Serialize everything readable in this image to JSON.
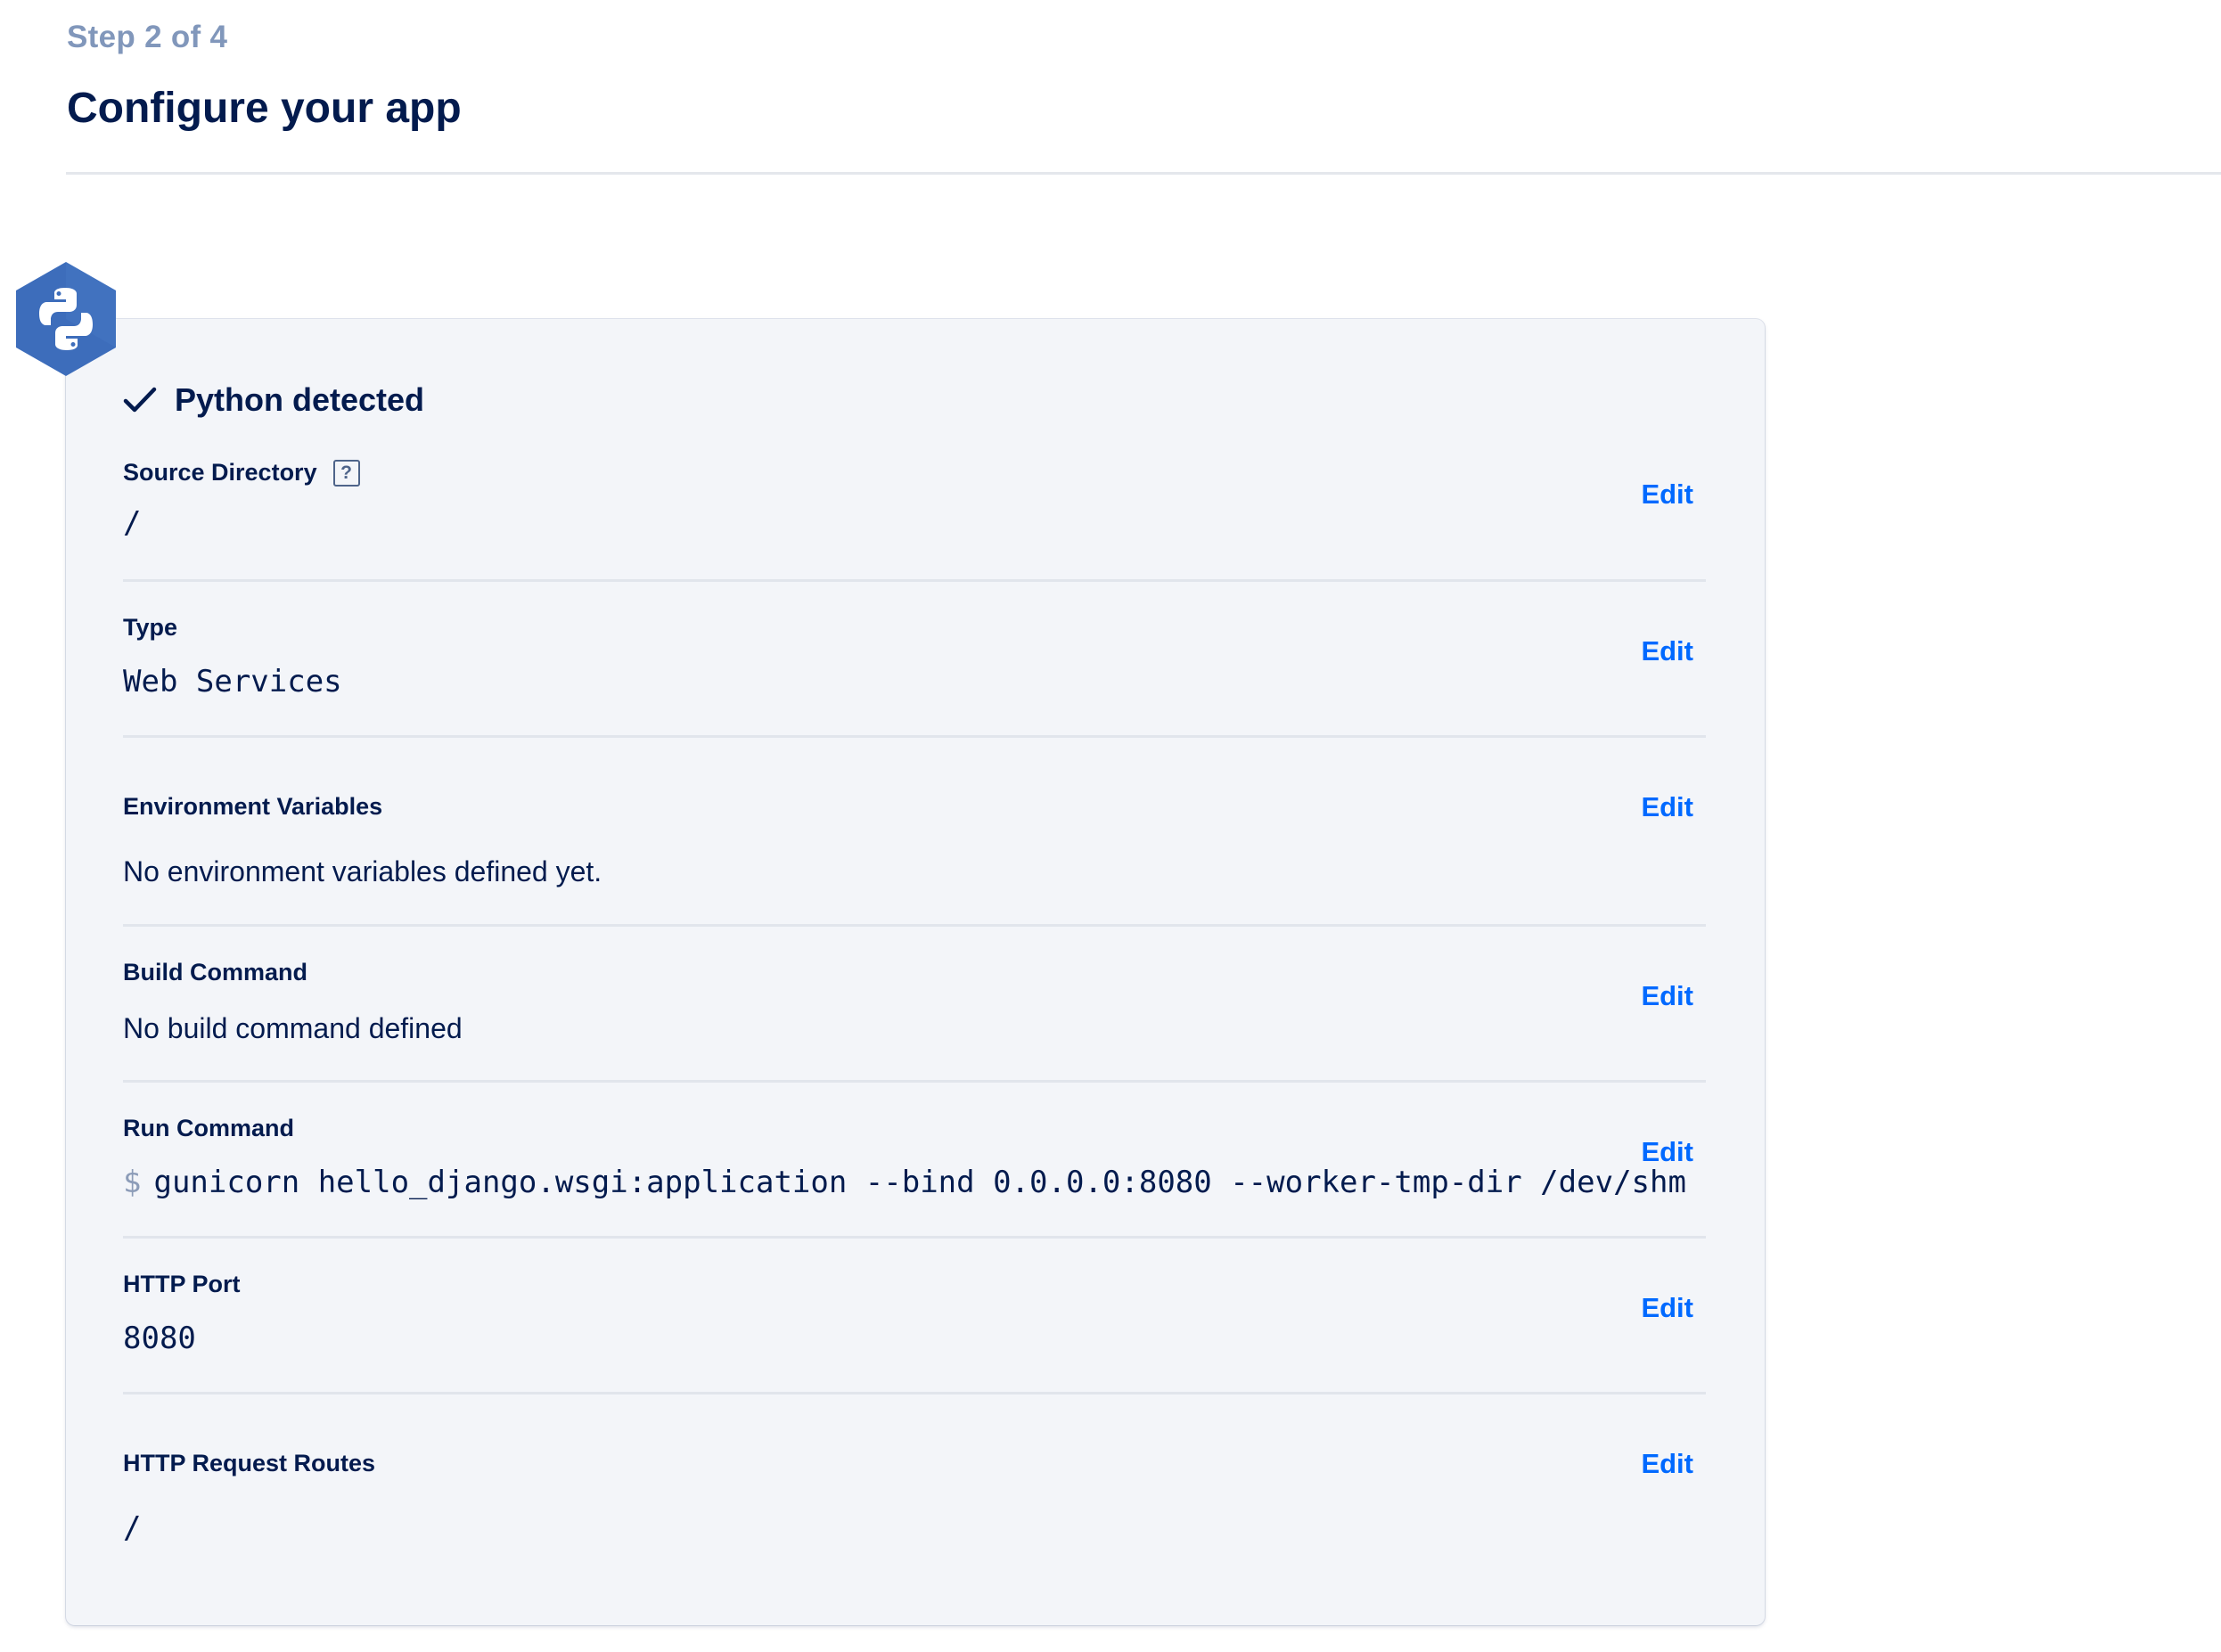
{
  "header": {
    "step": "Step 2 of 4",
    "title": "Configure your app"
  },
  "detection": {
    "label": "Python detected",
    "icon": "python-logo-icon"
  },
  "rows": [
    {
      "label": "Source Directory",
      "has_help": true,
      "help_glyph": "?",
      "value": "/",
      "value_style": "mono",
      "edit_label": "Edit"
    },
    {
      "label": "Type",
      "value": "Web Services",
      "value_style": "mono",
      "edit_label": "Edit"
    },
    {
      "label": "Environment Variables",
      "value": "No environment variables defined yet.",
      "value_style": "text",
      "edit_label": "Edit"
    },
    {
      "label": "Build Command",
      "value": "No build command defined",
      "value_style": "text",
      "edit_label": "Edit"
    },
    {
      "label": "Run Command",
      "prompt": "$",
      "value": "gunicorn hello_django.wsgi:application --bind 0.0.0.0:8080 --worker-tmp-dir /dev/shm",
      "value_style": "mono",
      "edit_label": "Edit"
    },
    {
      "label": "HTTP Port",
      "value": "8080",
      "value_style": "mono",
      "edit_label": "Edit"
    },
    {
      "label": "HTTP Request Routes",
      "value": "/",
      "value_style": "mono",
      "edit_label": "Edit"
    }
  ],
  "colors": {
    "accent": "#0069ff",
    "text": "#031b4e",
    "muted": "#8197bb",
    "card_bg": "#f3f5f9",
    "python_hex": "#3d6dbb"
  }
}
